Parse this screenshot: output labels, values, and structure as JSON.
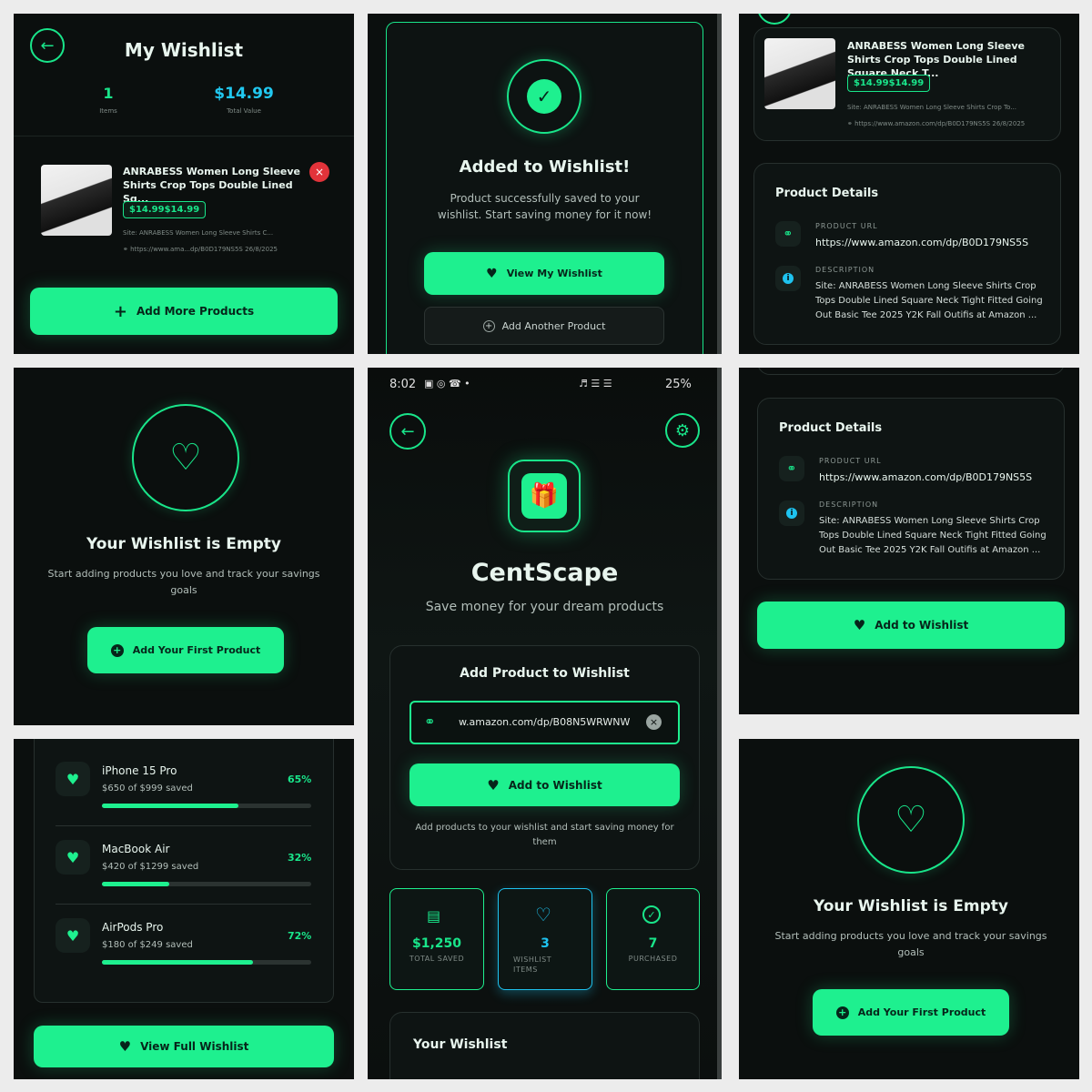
{
  "p1": {
    "title": "My Wishlist",
    "items_value": "1",
    "items_label": "Items",
    "total_value": "$14.99",
    "total_label": "Total Value",
    "product_title": "ANRABESS Women Long Sleeve Shirts Crop Tops Double Lined Sq...",
    "price": "$14.99$14.99",
    "site": "Site: ANRABESS Women Long Sleeve Shirts C...",
    "url": "https://www.ama...dp/B0D179NS5S",
    "date": "26/8/2025",
    "add_more": "Add More Products"
  },
  "p2": {
    "title": "Added to Wishlist!",
    "message": "Product successfully saved to your wishlist. Start saving money for it now!",
    "view_btn": "View My Wishlist",
    "another_btn": "Add Another Product"
  },
  "p3": {
    "product_title": "ANRABESS Women Long Sleeve Shirts Crop Tops Double Lined Square Neck T...",
    "price": "$14.99$14.99",
    "site": "Site: ANRABESS Women Long Sleeve Shirts Crop To...",
    "url": "https://www.amazon.com/dp/B0D179NS5S",
    "date": "26/8/2025",
    "details_title": "Product Details",
    "url_label": "PRODUCT URL",
    "url_value": "https://www.amazon.com/dp/B0D179NS5S",
    "desc_label": "DESCRIPTION",
    "desc_value": "Site: ANRABESS Women Long Sleeve Shirts Crop Tops Double Lined Square Neck Tight Fitted Going Out Basic Tee 2025 Y2K Fall Outifis at Amazon ..."
  },
  "p4": {
    "title": "Your Wishlist is Empty",
    "message": "Start adding products you love and track your savings goals",
    "btn": "Add Your First Product"
  },
  "p5": {
    "status_time": "8:02",
    "battery": "25%",
    "app_name": "CentScape",
    "tagline": "Save money for your dream products",
    "card_title": "Add Product to Wishlist",
    "input_value": "w.amazon.com/dp/B08N5WRWNW",
    "add_btn": "Add to Wishlist",
    "hint": "Add products to your wishlist and start saving money for them",
    "stats": [
      {
        "value": "$1,250",
        "label": "TOTAL SAVED"
      },
      {
        "value": "3",
        "label": "WISHLIST ITEMS"
      },
      {
        "value": "7",
        "label": "PURCHASED"
      }
    ],
    "wishlist_title": "Your Wishlist"
  },
  "p6": {
    "details_title": "Product Details",
    "url_label": "PRODUCT URL",
    "url_value": "https://www.amazon.com/dp/B0D179NS5S",
    "desc_label": "DESCRIPTION",
    "desc_value": "Site: ANRABESS Women Long Sleeve Shirts Crop Tops Double Lined Square Neck Tight Fitted Going Out Basic Tee 2025 Y2K Fall Outifis at Amazon ...",
    "btn": "Add to Wishlist"
  },
  "p7": {
    "items": [
      {
        "name": "iPhone 15 Pro",
        "sub": "$650 of $999 saved",
        "pct": "65%",
        "progress": 0.65
      },
      {
        "name": "MacBook Air",
        "sub": "$420 of $1299 saved",
        "pct": "32%",
        "progress": 0.32
      },
      {
        "name": "AirPods Pro",
        "sub": "$180 of $249 saved",
        "pct": "72%",
        "progress": 0.72
      }
    ],
    "btn": "View Full Wishlist"
  },
  "p8": {
    "title": "Your Wishlist is Empty",
    "message": "Start adding products you love and track your savings goals",
    "btn": "Add Your First Product"
  },
  "colors": {
    "accent": "#1ef08f",
    "background": "#0b0f0e",
    "danger": "#e2333a",
    "info": "#1ec3f0"
  }
}
